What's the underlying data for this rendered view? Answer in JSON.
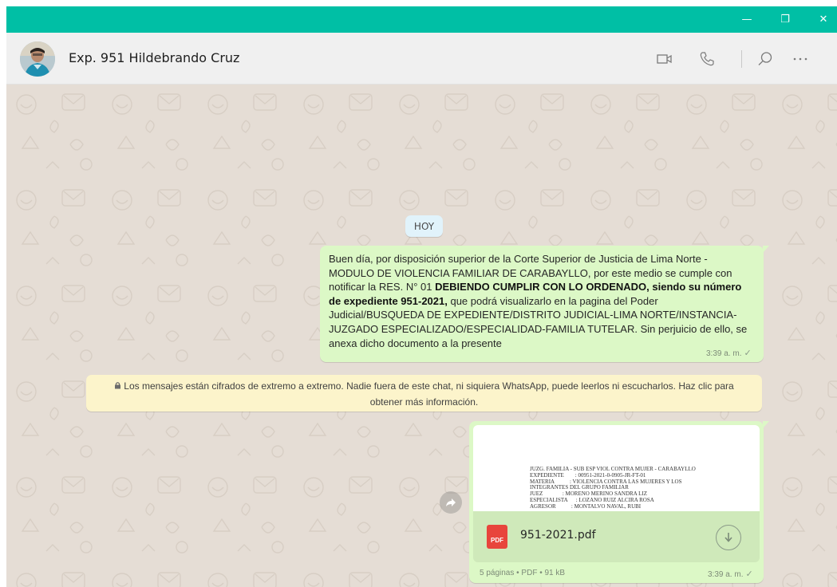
{
  "window": {
    "controls": {
      "minimize": "—",
      "maximize": "❐",
      "close": "✕"
    }
  },
  "header": {
    "title": "Exp. 951 Hildebrando Cruz",
    "icons": [
      "avatar",
      "video-camera-icon",
      "phone-icon",
      "search-icon",
      "more-options-icon"
    ]
  },
  "chat": {
    "date_chip": "HOY",
    "message1": {
      "part1": "Buen día, por disposición superior de la Corte Superior de Justicia de Lima Norte - MODULO DE VIOLENCIA FAMILIAR DE CARABAYLLO, por este medio se cumple con notificar la RES. N° 01 ",
      "bold": "DEBIENDO CUMPLIR CON LO ORDENADO, siendo su número de expediente 951-2021,",
      "part2": " que podrá visualizarlo en la pagina del Poder Judicial/BUSQUEDA DE EXPEDIENTE/DISTRITO JUDICIAL-LIMA NORTE/INSTANCIA-JUZGADO ESPECIALIZADO/ESPECIALIDAD-FAMILIA TUTELAR. Sin perjuicio de ello, se anexa dicho documento a la presente",
      "time": "3:39 a. m.",
      "status": "✓"
    },
    "encryption_notice": "Los mensajes están cifrados de extremo a extremo. Nadie fuera de este chat, ni siquiera WhatsApp, puede leerlos ni escucharlos. Haz clic para obtener más información.",
    "message2": {
      "preview_lines": [
        "JUZG. FAMILIA - SUB ESP VIOL CONTRA MUJER - CARABAYLLO",
        "EXPEDIENTE        : 00951-2021-0-0905-JR-FT-01",
        "MATERIA           : VIOLENCIA CONTRA LAS MUJERES Y LOS",
        "INTEGRANTES DEL GRUPO FAMILIAR",
        "JUEZ              : MORENO MERINO SANDRA LIZ",
        "ESPECIALISTA      : LOZANO RUIZ ALCIRA ROSA",
        "AGRESOR           : MONTALVO NAVAL, RUBI"
      ],
      "pdf_badge": "PDF",
      "file_name": "951-2021.pdf",
      "meta": "5 páginas • PDF • 91 kB",
      "time": "3:39 a. m.",
      "status": "✓"
    }
  },
  "colors": {
    "titlebar": "#00bfa5",
    "header_bg": "#f0f0f0",
    "chat_bg": "#e5ddd5",
    "outgoing_bubble": "#dcf8c6",
    "date_chip": "#e1f3fb",
    "system_note": "#fcf4cb",
    "pdf_red": "#e8453c"
  }
}
